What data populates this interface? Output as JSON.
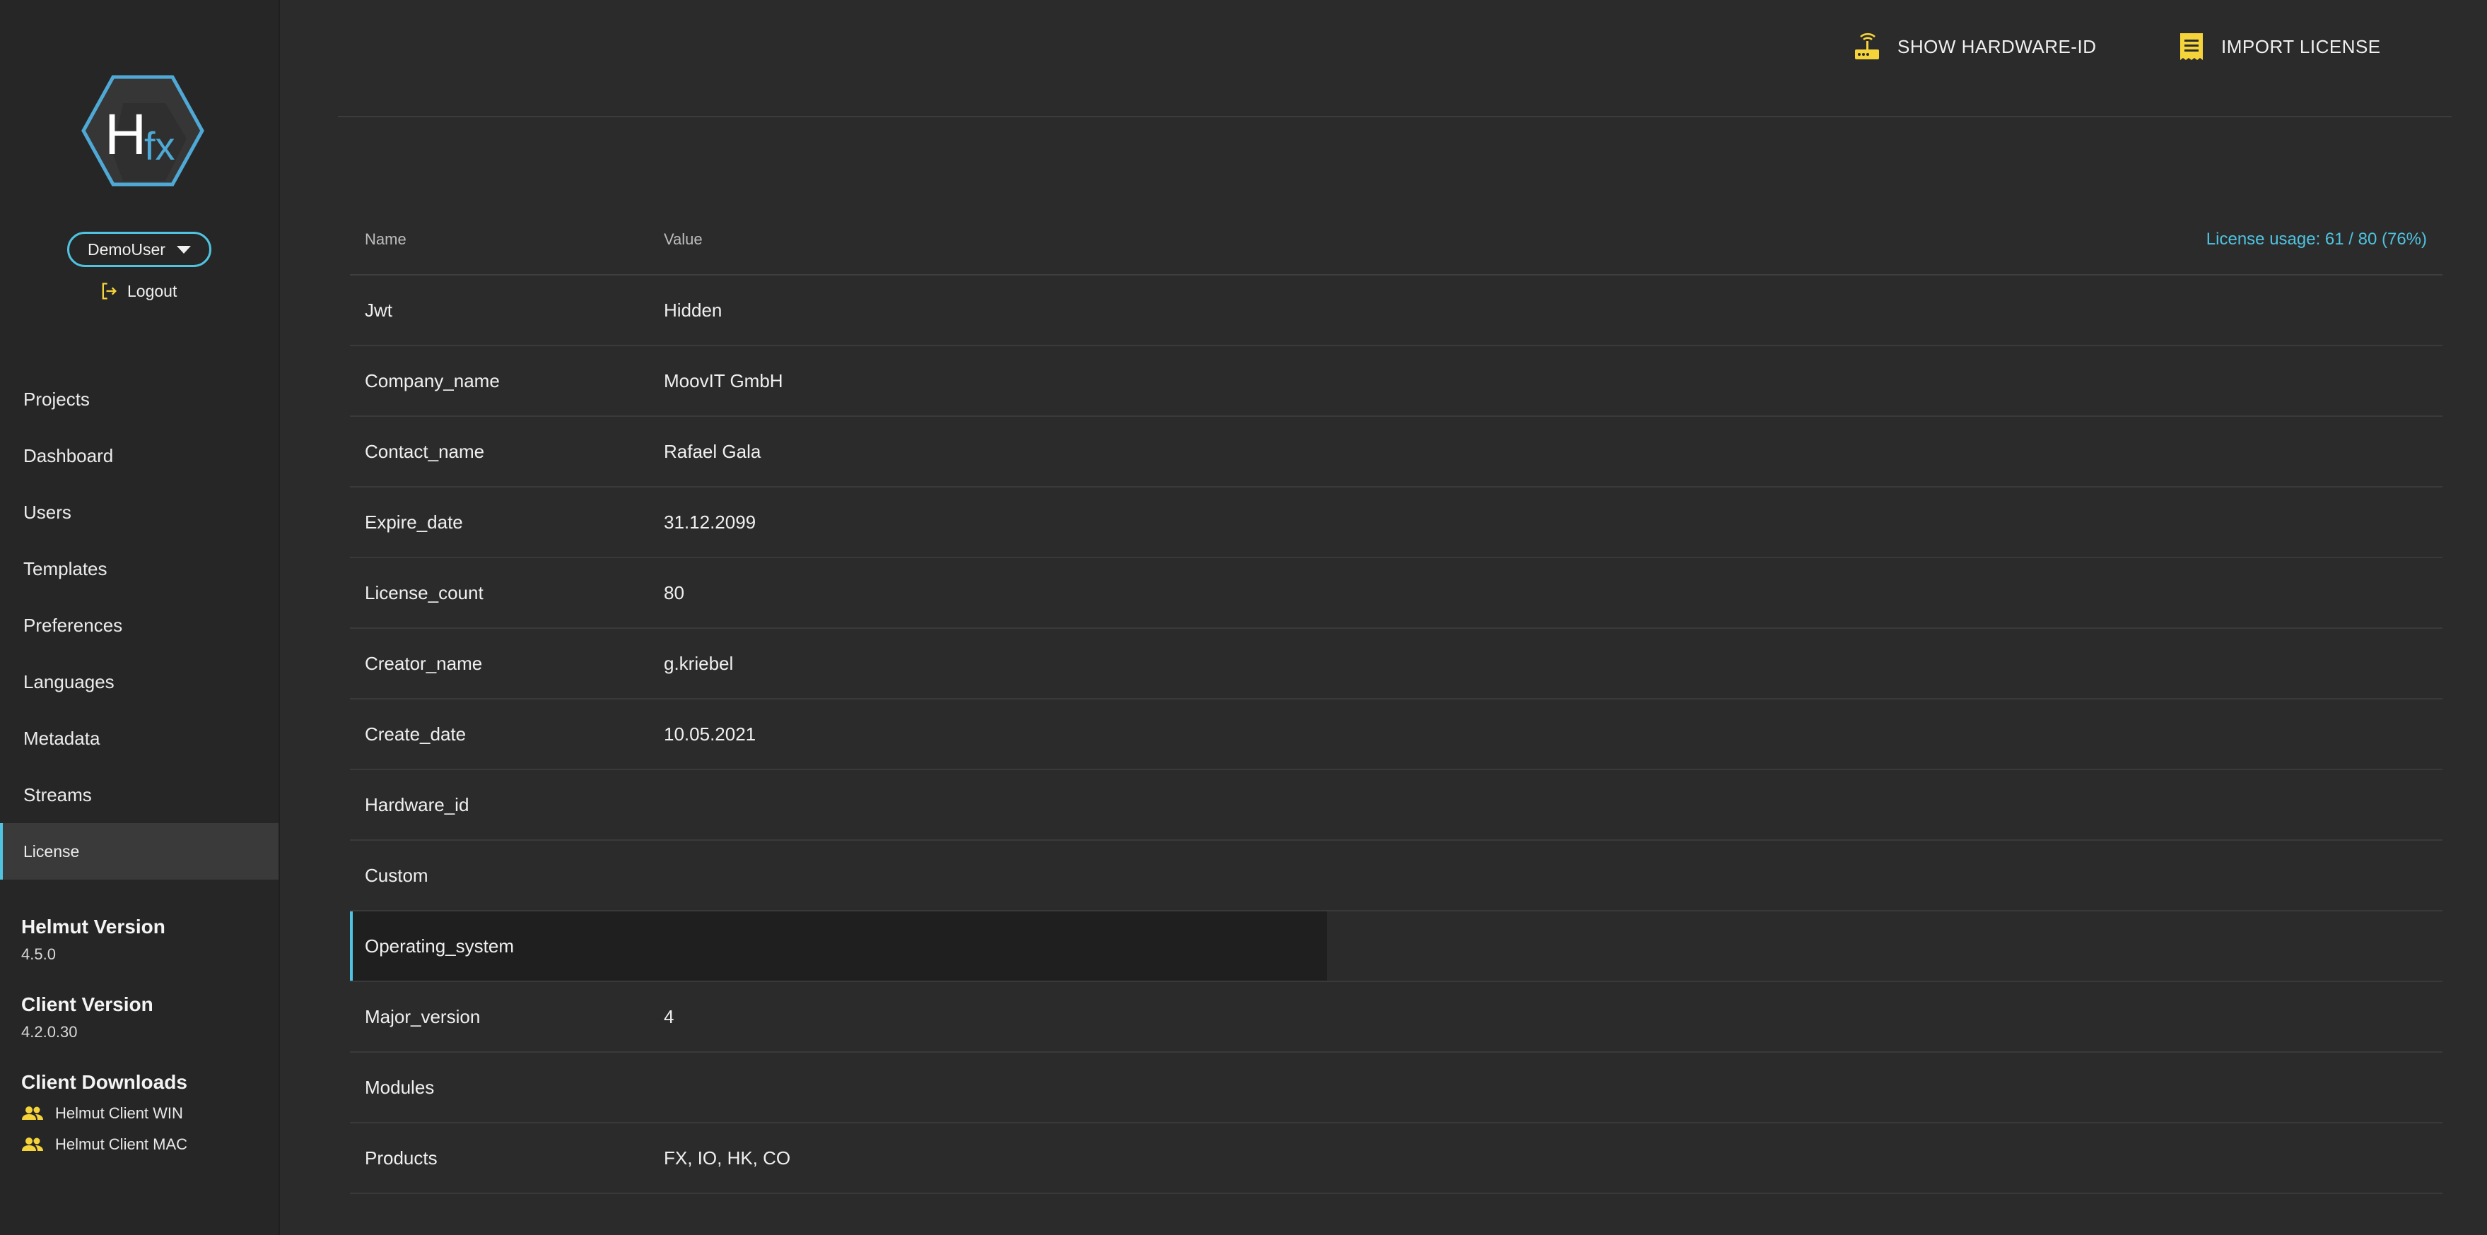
{
  "sidebar": {
    "logo_text": "Hfx",
    "user": {
      "name": "DemoUser"
    },
    "logout_label": "Logout",
    "nav": [
      {
        "label": "Projects",
        "active": false
      },
      {
        "label": "Dashboard",
        "active": false
      },
      {
        "label": "Users",
        "active": false
      },
      {
        "label": "Templates",
        "active": false
      },
      {
        "label": "Preferences",
        "active": false
      },
      {
        "label": "Languages",
        "active": false
      },
      {
        "label": "Metadata",
        "active": false
      },
      {
        "label": "Streams",
        "active": false
      },
      {
        "label": "License",
        "active": true
      }
    ],
    "helmut_version": {
      "title": "Helmut Version",
      "value": "4.5.0"
    },
    "client_version": {
      "title": "Client Version",
      "value": "4.2.0.30"
    },
    "client_downloads": {
      "title": "Client Downloads",
      "items": [
        {
          "label": "Helmut Client WIN",
          "icon": "people-icon"
        },
        {
          "label": "Helmut Client MAC",
          "icon": "people-icon"
        }
      ]
    }
  },
  "toolbar": {
    "show_hardware_id": "SHOW HARDWARE-ID",
    "import_license": "IMPORT LICENSE"
  },
  "table": {
    "headers": {
      "name": "Name",
      "value": "Value"
    },
    "usage": "License usage: 61 / 80 (76%)",
    "rows": [
      {
        "name": "Jwt",
        "value": "Hidden"
      },
      {
        "name": "Company_name",
        "value": "MoovIT GmbH"
      },
      {
        "name": "Contact_name",
        "value": "Rafael Gala"
      },
      {
        "name": "Expire_date",
        "value": "31.12.2099"
      },
      {
        "name": "License_count",
        "value": "80"
      },
      {
        "name": "Creator_name",
        "value": "g.kriebel"
      },
      {
        "name": "Create_date",
        "value": "10.05.2021"
      },
      {
        "name": "Hardware_id",
        "value": ""
      },
      {
        "name": "Custom",
        "value": ""
      },
      {
        "name": "Operating_system",
        "value": "",
        "hovered": true
      },
      {
        "name": "Major_version",
        "value": "4"
      },
      {
        "name": "Modules",
        "value": ""
      },
      {
        "name": "Products",
        "value": "FX, IO, HK, CO"
      }
    ]
  },
  "colors": {
    "accent": "#4fc3e0",
    "icon_yellow": "#f5d33a",
    "background": "#2b2b2b",
    "sidebar": "#262626"
  }
}
